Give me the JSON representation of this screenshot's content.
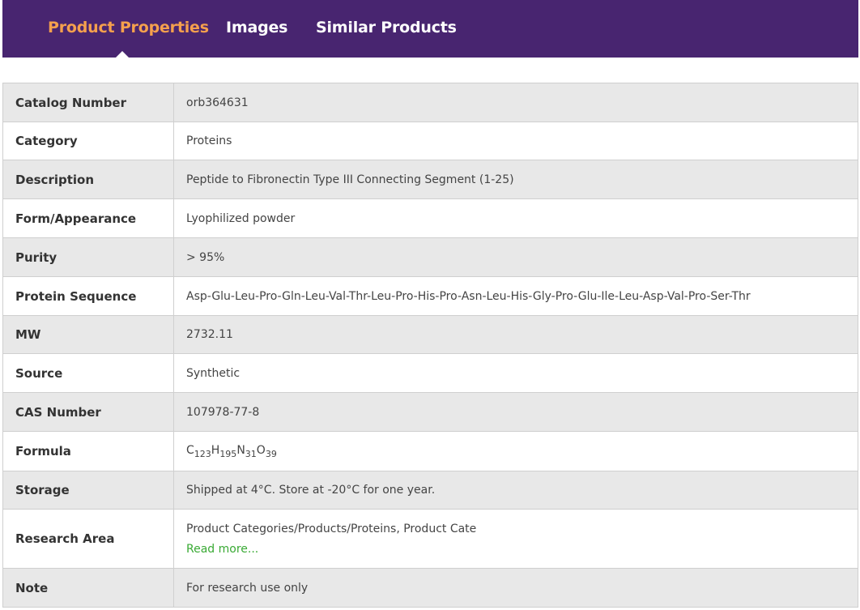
{
  "tabs": [
    {
      "label": "Product Properties",
      "active": true
    },
    {
      "label": "Images",
      "active": false
    },
    {
      "label": "Similar Products",
      "active": false
    }
  ],
  "rows": [
    {
      "label": "Catalog Number",
      "value": "orb364631"
    },
    {
      "label": "Category",
      "value": "Proteins"
    },
    {
      "label": "Description",
      "value": "Peptide to Fibronectin Type III Connecting Segment (1-25)"
    },
    {
      "label": "Form/Appearance",
      "value": "Lyophilized powder"
    },
    {
      "label": "Purity",
      "value": "> 95%"
    },
    {
      "label": "Protein Sequence",
      "value": "Asp-Glu-Leu-Pro-Gln-Leu-Val-Thr-Leu-Pro-His-Pro-Asn-Leu-His-Gly-Pro-Glu-Ile-Leu-Asp-Val-Pro-Ser-Thr"
    },
    {
      "label": "MW",
      "value": "2732.11"
    },
    {
      "label": "Source",
      "value": "Synthetic"
    },
    {
      "label": "CAS Number",
      "value": "107978-77-8"
    },
    {
      "label": "Formula",
      "formula": [
        {
          "el": "C",
          "n": "123"
        },
        {
          "el": "H",
          "n": "195"
        },
        {
          "el": "N",
          "n": "31"
        },
        {
          "el": "O",
          "n": "39"
        }
      ]
    },
    {
      "label": "Storage",
      "value": "Shipped at 4°C. Store at -20°C for one year."
    },
    {
      "label": "Research Area",
      "value": "Product Categories/Products/Proteins, Product Cate",
      "link": "Read more..."
    },
    {
      "label": "Note",
      "value": "For research use only"
    }
  ],
  "colors": {
    "header_bg": "#482570",
    "active_tab": "#f5a04d",
    "link": "#3aaa35"
  }
}
